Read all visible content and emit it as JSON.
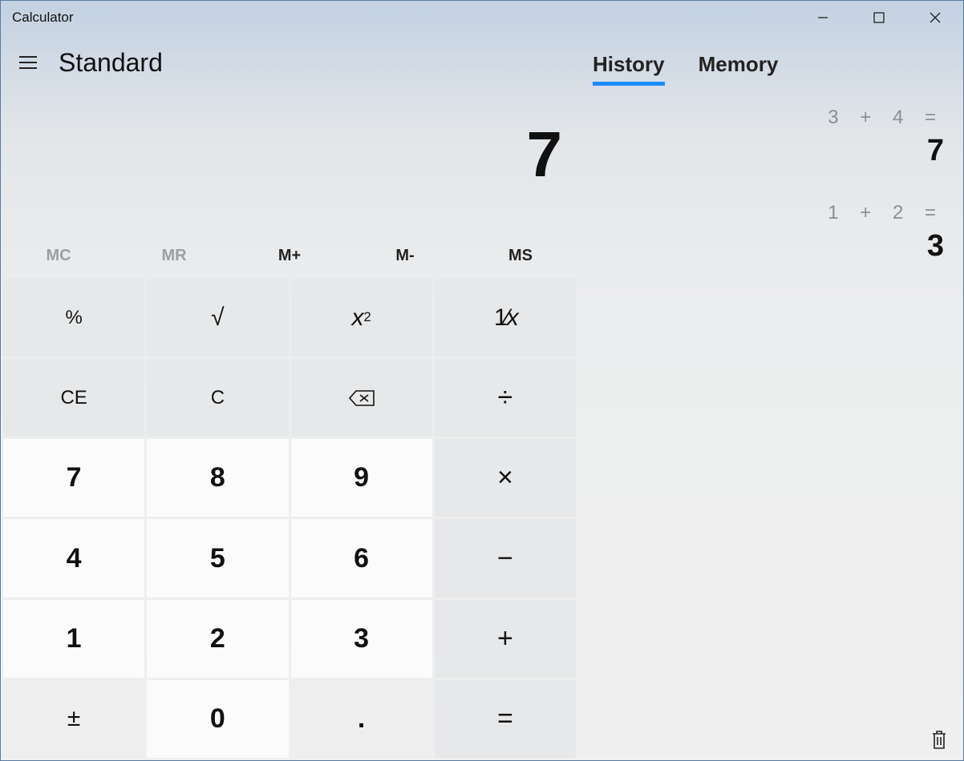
{
  "window": {
    "title": "Calculator"
  },
  "mode": {
    "title": "Standard"
  },
  "display": {
    "value": "7"
  },
  "memory_buttons": {
    "mc": "MC",
    "mr": "MR",
    "mplus": "M+",
    "mminus": "M-",
    "ms": "MS"
  },
  "keys": {
    "percent": "%",
    "sqrt": "√",
    "square_base": "x",
    "square_exp": "2",
    "recip_num": "1",
    "recip_slash": "⁄",
    "recip_den": "x",
    "ce": "CE",
    "c": "C",
    "divide": "÷",
    "multiply": "×",
    "minus": "−",
    "plus": "+",
    "equals": "=",
    "negate": "±",
    "decimal": ".",
    "d0": "0",
    "d1": "1",
    "d2": "2",
    "d3": "3",
    "d4": "4",
    "d5": "5",
    "d6": "6",
    "d7": "7",
    "d8": "8",
    "d9": "9"
  },
  "tabs": {
    "history": "History",
    "memory": "Memory",
    "active": "history"
  },
  "history": [
    {
      "expr": "3   +   4 =",
      "result": "7"
    },
    {
      "expr": "1   +   2 =",
      "result": "3"
    }
  ]
}
